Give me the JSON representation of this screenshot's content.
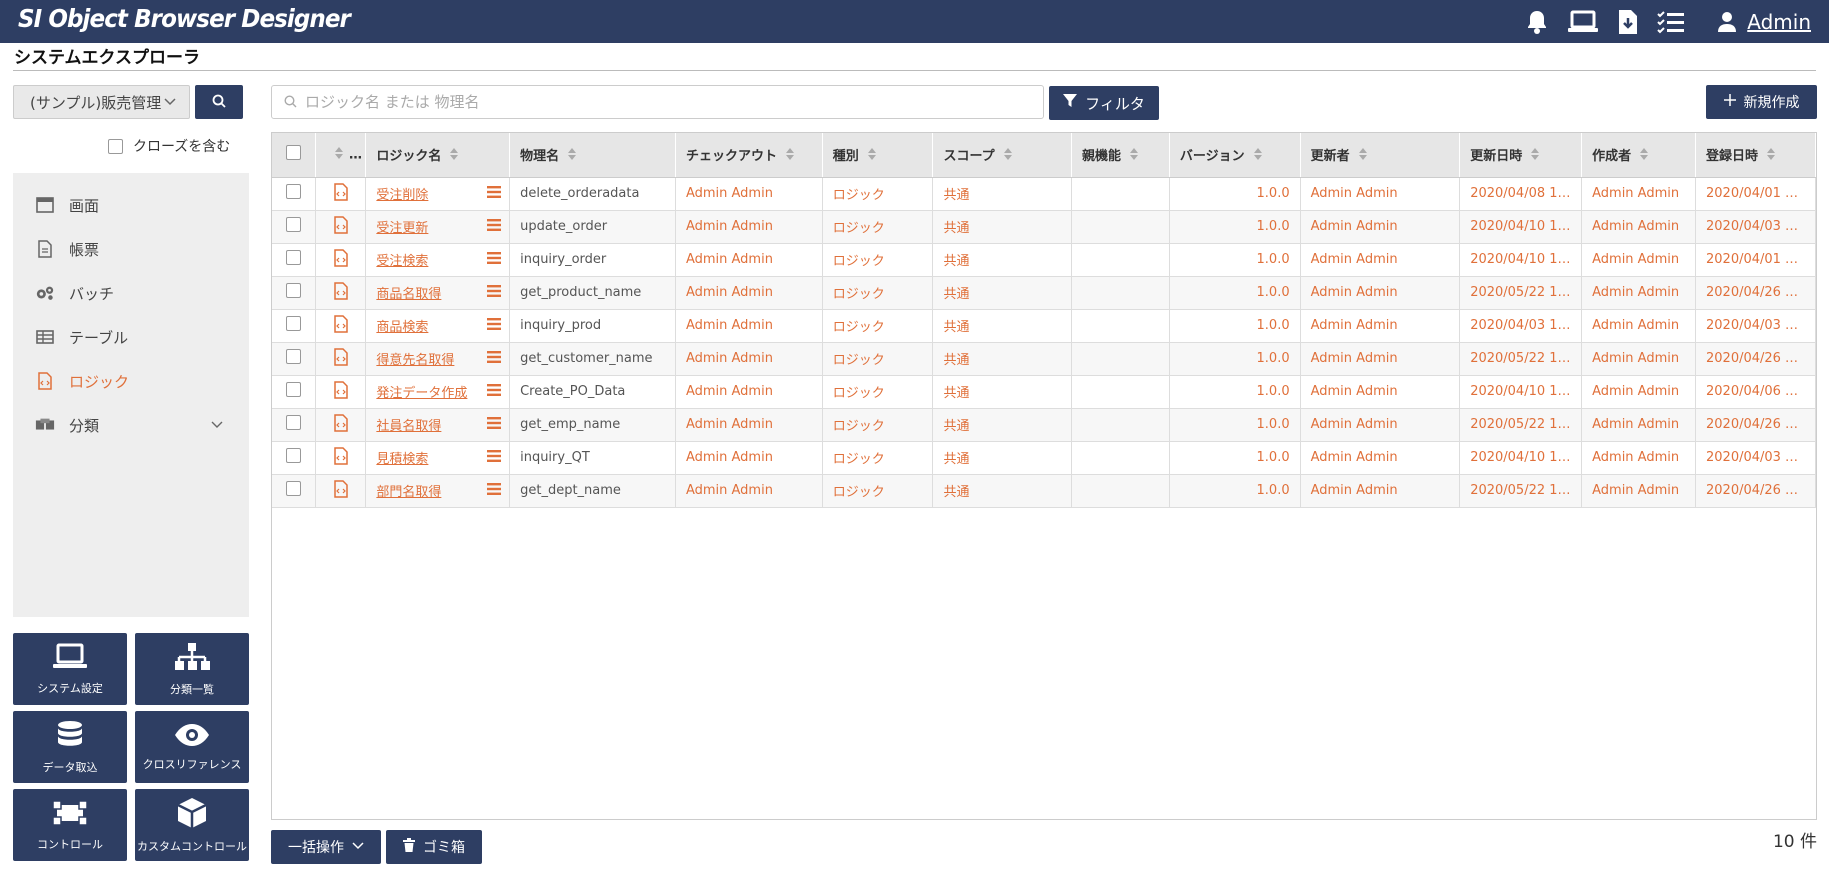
{
  "app": {
    "title": "SI Object Browser Designer",
    "user": "Admin"
  },
  "page": {
    "title": "システムエクスプローラ"
  },
  "sidebar": {
    "project": "(サンプル)販売管理",
    "include_closed": "クローズを含む",
    "items": [
      {
        "label": "画面",
        "icon": "window-icon"
      },
      {
        "label": "帳票",
        "icon": "document-icon"
      },
      {
        "label": "バッチ",
        "icon": "gears-icon"
      },
      {
        "label": "テーブル",
        "icon": "table-icon"
      },
      {
        "label": "ロジック",
        "icon": "code-file-icon",
        "active": true
      },
      {
        "label": "分類",
        "icon": "boxes-icon"
      }
    ],
    "tiles": [
      {
        "label": "システム設定",
        "icon": "laptop-icon"
      },
      {
        "label": "分類一覧",
        "icon": "sitemap-icon"
      },
      {
        "label": "データ取込",
        "icon": "database-icon"
      },
      {
        "label": "クロスリファレンス",
        "icon": "eye-icon"
      },
      {
        "label": "コントロール",
        "icon": "control-icon"
      },
      {
        "label": "カスタムコントロール",
        "icon": "cube-icon"
      }
    ]
  },
  "toolbar": {
    "search_placeholder": "ロジック名 または 物理名",
    "filter_label": "フィルタ",
    "new_label": "新規作成"
  },
  "table": {
    "columns": [
      "…",
      "ロジック名",
      "物理名",
      "チェックアウト",
      "種別",
      "スコープ",
      "親機能",
      "バージョン",
      "更新者",
      "更新日時",
      "作成者",
      "登録日時"
    ],
    "rows": [
      {
        "name": "受注削除",
        "physical": "delete_orderadata",
        "checkout": "Admin Admin",
        "kind": "ロジック",
        "scope": "共通",
        "parent": "",
        "version": "1.0.0",
        "updater": "Admin Admin",
        "updated": "2020/04/08 1…",
        "creator": "Admin Admin",
        "created": "2020/04/01 …"
      },
      {
        "name": "受注更新",
        "physical": "update_order",
        "checkout": "Admin Admin",
        "kind": "ロジック",
        "scope": "共通",
        "parent": "",
        "version": "1.0.0",
        "updater": "Admin Admin",
        "updated": "2020/04/10 1…",
        "creator": "Admin Admin",
        "created": "2020/04/03 …"
      },
      {
        "name": "受注検索",
        "physical": "inquiry_order",
        "checkout": "Admin Admin",
        "kind": "ロジック",
        "scope": "共通",
        "parent": "",
        "version": "1.0.0",
        "updater": "Admin Admin",
        "updated": "2020/04/10 1…",
        "creator": "Admin Admin",
        "created": "2020/04/01 …"
      },
      {
        "name": "商品名取得",
        "physical": "get_product_name",
        "checkout": "Admin Admin",
        "kind": "ロジック",
        "scope": "共通",
        "parent": "",
        "version": "1.0.0",
        "updater": "Admin Admin",
        "updated": "2020/05/22 1…",
        "creator": "Admin Admin",
        "created": "2020/04/26 …"
      },
      {
        "name": "商品検索",
        "physical": "inquiry_prod",
        "checkout": "Admin Admin",
        "kind": "ロジック",
        "scope": "共通",
        "parent": "",
        "version": "1.0.0",
        "updater": "Admin Admin",
        "updated": "2020/04/03 1…",
        "creator": "Admin Admin",
        "created": "2020/04/03 …"
      },
      {
        "name": "得意先名取得",
        "physical": "get_customer_name",
        "checkout": "Admin Admin",
        "kind": "ロジック",
        "scope": "共通",
        "parent": "",
        "version": "1.0.0",
        "updater": "Admin Admin",
        "updated": "2020/05/22 1…",
        "creator": "Admin Admin",
        "created": "2020/04/26 …"
      },
      {
        "name": "発注データ作成",
        "physical": "Create_PO_Data",
        "checkout": "Admin Admin",
        "kind": "ロジック",
        "scope": "共通",
        "parent": "",
        "version": "1.0.0",
        "updater": "Admin Admin",
        "updated": "2020/04/10 1…",
        "creator": "Admin Admin",
        "created": "2020/04/06 …"
      },
      {
        "name": "社員名取得",
        "physical": "get_emp_name",
        "checkout": "Admin Admin",
        "kind": "ロジック",
        "scope": "共通",
        "parent": "",
        "version": "1.0.0",
        "updater": "Admin Admin",
        "updated": "2020/05/22 1…",
        "creator": "Admin Admin",
        "created": "2020/04/26 …"
      },
      {
        "name": "見積検索",
        "physical": "inquiry_QT",
        "checkout": "Admin Admin",
        "kind": "ロジック",
        "scope": "共通",
        "parent": "",
        "version": "1.0.0",
        "updater": "Admin Admin",
        "updated": "2020/04/10 1…",
        "creator": "Admin Admin",
        "created": "2020/04/03 …"
      },
      {
        "name": "部門名取得",
        "physical": "get_dept_name",
        "checkout": "Admin Admin",
        "kind": "ロジック",
        "scope": "共通",
        "parent": "",
        "version": "1.0.0",
        "updater": "Admin Admin",
        "updated": "2020/05/22 1…",
        "creator": "Admin Admin",
        "created": "2020/04/26 …"
      }
    ]
  },
  "footer": {
    "bulk_label": "一括操作",
    "trash_label": "ゴミ箱",
    "count": "10 件"
  },
  "colors": {
    "navy": "#2e3e63",
    "accent": "#e0703a"
  }
}
